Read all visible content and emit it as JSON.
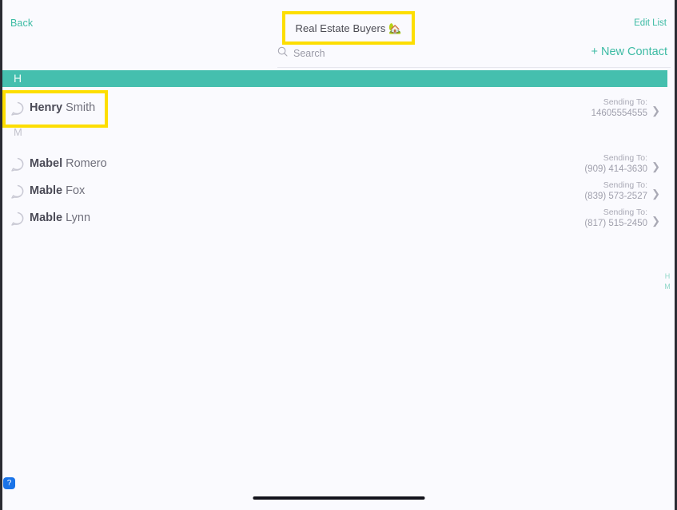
{
  "header": {
    "back_label": "Back",
    "title": "Real Estate Buyers 🏡",
    "edit_list_label": "Edit List",
    "new_contact_label": "+ New Contact"
  },
  "search": {
    "placeholder": "Search",
    "value": "",
    "icon": "search-icon"
  },
  "sections": [
    {
      "letter": "H",
      "style": "teal",
      "contacts": [
        {
          "first_name": "Henry",
          "last_name": "Smith",
          "sending_label": "Sending To:",
          "phone": "14605554555",
          "chevron": "❯",
          "avatar_icon": "chat-bubble-icon",
          "highlighted": true
        }
      ]
    },
    {
      "letter": "M",
      "style": "plain",
      "contacts": [
        {
          "first_name": "Mabel",
          "last_name": "Romero",
          "sending_label": "Sending To:",
          "phone": "(909) 414-3630",
          "chevron": "❯",
          "avatar_icon": "chat-bubble-icon",
          "highlighted": false
        },
        {
          "first_name": "Mable",
          "last_name": "Fox",
          "sending_label": "Sending To:",
          "phone": "(839) 573-2527",
          "chevron": "❯",
          "avatar_icon": "chat-bubble-icon",
          "highlighted": false
        },
        {
          "first_name": "Mable",
          "last_name": "Lynn",
          "sending_label": "Sending To:",
          "phone": "(817) 515-2450",
          "chevron": "❯",
          "avatar_icon": "chat-bubble-icon",
          "highlighted": false
        }
      ]
    }
  ],
  "alpha_index": [
    "H",
    "M"
  ],
  "help_button": {
    "label": "?"
  },
  "colors": {
    "accent_teal": "#3dbba4",
    "section_teal": "#45bfae",
    "highlight_yellow": "#fdde00",
    "help_blue": "#1a73e8",
    "background": "#fafafe"
  }
}
